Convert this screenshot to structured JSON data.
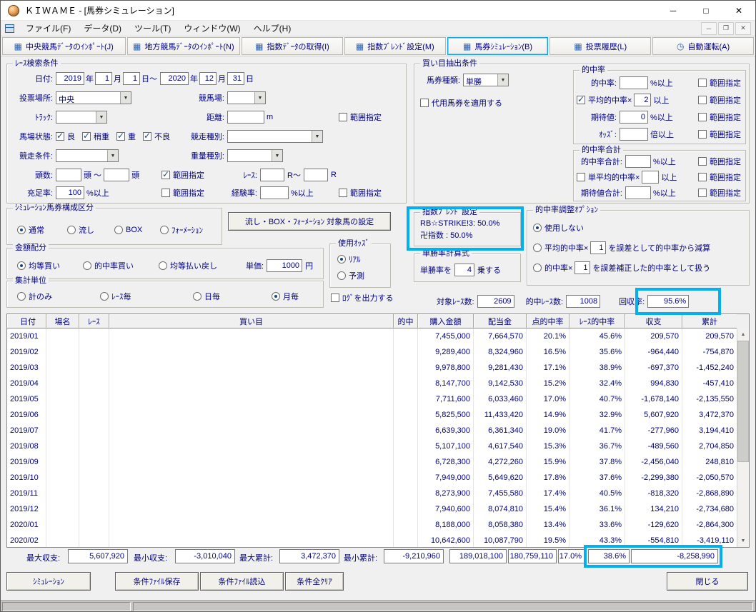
{
  "window": {
    "title": "ＫＩＷＡＭＥ - [馬券シミュレーション]",
    "minimize": "─",
    "maximize": "□",
    "close": "✕"
  },
  "menubar": {
    "items": [
      "ファイル(F)",
      "データ(D)",
      "ツール(T)",
      "ウィンドウ(W)",
      "ヘルプ(H)"
    ],
    "mdi_minimize": "─",
    "mdi_restore": "❐",
    "mdi_close": "✕"
  },
  "toolbar": {
    "buttons": [
      "中央競馬ﾃﾞｰﾀのｲﾝﾎﾟｰﾄ(J)",
      "地方競馬ﾃﾞｰﾀのｲﾝﾎﾟｰﾄ(N)",
      "指数ﾃﾞｰﾀの取得(I)",
      "指数ﾌﾞﾚﾝﾄﾞ設定(M)",
      "馬券ｼﾐｭﾚｰｼｮﾝ(B)",
      "投票履歴(L)",
      "自動運転(A)"
    ]
  },
  "range_label": "範囲指定",
  "search": {
    "title": "ﾚｰｽ検索条件",
    "date_label": "日付:",
    "from_year": "2019",
    "from_month": "1",
    "from_day": "1",
    "to_year": "2020",
    "to_month": "12",
    "to_day": "31",
    "u_year": "年",
    "u_month": "月",
    "u_day_tilde": "日～",
    "u_day": "日",
    "place_label": "投票場所:",
    "place_value": "中央",
    "course_label": "競馬場:",
    "course_value": "",
    "track_label": "ﾄﾗｯｸ:",
    "track_value": "",
    "distance_label": "距離:",
    "distance_value": "",
    "distance_unit": "m",
    "baba_label": "馬場状態:",
    "baba_options": [
      "良",
      "稍重",
      "重",
      "不良"
    ],
    "race_kind_label": "競走種別:",
    "race_kind_value": "",
    "race_cond_label": "競走条件:",
    "race_cond_value": "",
    "weight_kind_label": "重量種別:",
    "weight_kind_value": "",
    "heads_label": "頭数:",
    "heads_from": "",
    "heads_to": "",
    "u_head_tilde": "頭 ～",
    "u_head": "頭",
    "raceno_label": "ﾚｰｽ:",
    "raceno_from": "",
    "raceno_to": "",
    "u_r_tilde": "R～",
    "u_r": "R",
    "fill_label": "充足率:",
    "fill_value": "100",
    "u_pct_over": "%以上",
    "exp_label": "経験率:",
    "exp_value": ""
  },
  "extract": {
    "title": "買い目抽出条件",
    "ticket_label": "馬券種類:",
    "ticket_value": "単勝",
    "substitute_label": "代用馬券を適用する",
    "hit": {
      "title": "的中率",
      "rate_label": "的中率:",
      "rate_value": "",
      "u_pct": "%以上",
      "avg_label": "平均的中率×",
      "avg_value": "2",
      "u_over": "以上",
      "expect_label": "期待値:",
      "expect_value": "0",
      "odds_label": "ｵｯｽﾞ:",
      "odds_value": "",
      "u_times": "倍以上"
    },
    "total": {
      "title": "的中率合計",
      "rate_label": "的中率合計:",
      "rate_value": "",
      "u_pct": "%以上",
      "avg_label": "単平均的中率×",
      "avg_value": "",
      "u_over": "以上",
      "expect_label": "期待値合計:",
      "expect_value": ""
    }
  },
  "sim_type": {
    "title": "ｼﾐｭﾚｰｼｮﾝ馬券構成区分",
    "options": [
      "通常",
      "流し",
      "BOX",
      "ﾌｫｰﾒｰｼｮﾝ"
    ],
    "button_label": "流し・BOX・ﾌｫｰﾒｰｼｮﾝ 対象馬の設定"
  },
  "money": {
    "title": "金額配分",
    "options": [
      "均等買い",
      "的中率買い",
      "均等払い戻し"
    ],
    "price_label": "単価:",
    "price_value": "1000",
    "price_unit": "円"
  },
  "odds_used": {
    "title": "使用ｵｯｽﾞ",
    "options": [
      "ﾘｱﾙ",
      "予測"
    ]
  },
  "agg_unit": {
    "title": "集計単位",
    "options": [
      "計のみ",
      "ﾚｰｽ毎",
      "日毎",
      "月毎"
    ]
  },
  "log_label": "ﾛｸﾞを出力する",
  "blend": {
    "title": "指数ﾌﾞﾚﾝﾄﾞ設定",
    "line1": "RB☆STRIKE!3: 50.0%",
    "line2": "卍指数 : 50.0%"
  },
  "win_rate": {
    "title": "単勝率計算式",
    "prefix": "単勝率を",
    "value": "4",
    "suffix": "乗する"
  },
  "adjust": {
    "title": "的中率調整ｵﾌﾟｼｮﾝ",
    "opt1": "使用しない",
    "opt2_pre": "平均的中率×",
    "opt2_value": "1",
    "opt2_post": "を誤差として的中率から減算",
    "opt3_pre": "的中率×",
    "opt3_value": "1",
    "opt3_post": "を誤差補正した的中率として扱う"
  },
  "counts": {
    "target_label": "対象ﾚｰｽ数:",
    "target_value": "2609",
    "hit_label": "的中ﾚｰｽ数:",
    "hit_value": "1008",
    "payback_label": "回収率:",
    "payback_value": "95.6%"
  },
  "table": {
    "columns": [
      "日付",
      "場名",
      "ﾚｰｽ",
      "買い目",
      "的中",
      "購入金額",
      "配当金",
      "点的中率",
      "ﾚｰｽ的中率",
      "収支",
      "累計"
    ],
    "rows": [
      [
        "2019/01",
        "",
        "",
        "",
        "",
        "7,455,000",
        "7,664,570",
        "20.1%",
        "45.6%",
        "209,570",
        "209,570"
      ],
      [
        "2019/02",
        "",
        "",
        "",
        "",
        "9,289,400",
        "8,324,960",
        "16.5%",
        "35.6%",
        "-964,440",
        "-754,870"
      ],
      [
        "2019/03",
        "",
        "",
        "",
        "",
        "9,978,800",
        "9,281,430",
        "17.1%",
        "38.9%",
        "-697,370",
        "-1,452,240"
      ],
      [
        "2019/04",
        "",
        "",
        "",
        "",
        "8,147,700",
        "9,142,530",
        "15.2%",
        "32.4%",
        "994,830",
        "-457,410"
      ],
      [
        "2019/05",
        "",
        "",
        "",
        "",
        "7,711,600",
        "6,033,460",
        "17.0%",
        "40.7%",
        "-1,678,140",
        "-2,135,550"
      ],
      [
        "2019/06",
        "",
        "",
        "",
        "",
        "5,825,500",
        "11,433,420",
        "14.9%",
        "32.9%",
        "5,607,920",
        "3,472,370"
      ],
      [
        "2019/07",
        "",
        "",
        "",
        "",
        "6,639,300",
        "6,361,340",
        "19.0%",
        "41.7%",
        "-277,960",
        "3,194,410"
      ],
      [
        "2019/08",
        "",
        "",
        "",
        "",
        "5,107,100",
        "4,617,540",
        "15.3%",
        "36.7%",
        "-489,560",
        "2,704,850"
      ],
      [
        "2019/09",
        "",
        "",
        "",
        "",
        "6,728,300",
        "4,272,260",
        "15.9%",
        "37.8%",
        "-2,456,040",
        "248,810"
      ],
      [
        "2019/10",
        "",
        "",
        "",
        "",
        "7,949,000",
        "5,649,620",
        "17.8%",
        "37.6%",
        "-2,299,380",
        "-2,050,570"
      ],
      [
        "2019/11",
        "",
        "",
        "",
        "",
        "8,273,900",
        "7,455,580",
        "17.4%",
        "40.5%",
        "-818,320",
        "-2,868,890"
      ],
      [
        "2019/12",
        "",
        "",
        "",
        "",
        "7,940,600",
        "8,074,810",
        "15.4%",
        "36.1%",
        "134,210",
        "-2,734,680"
      ],
      [
        "2020/01",
        "",
        "",
        "",
        "",
        "8,188,000",
        "8,058,380",
        "13.4%",
        "33.6%",
        "-129,620",
        "-2,864,300"
      ],
      [
        "2020/02",
        "",
        "",
        "",
        "",
        "10,642,600",
        "10,087,790",
        "19.5%",
        "43.3%",
        "-554,810",
        "-3,419,110"
      ]
    ]
  },
  "summary": {
    "max_balance_label": "最大収支:",
    "max_balance": "5,607,920",
    "min_balance_label": "最小収支:",
    "min_balance": "-3,010,040",
    "max_cum_label": "最大累計:",
    "max_cum": "3,472,370",
    "min_cum_label": "最小累計:",
    "min_cum": "-9,210,960",
    "purchase_total": "189,018,100",
    "payout_total": "180,759,110",
    "hit_rate": "17.0%",
    "race_hit_rate": "38.6%",
    "balance": "-8,258,990"
  },
  "footer": {
    "buttons": [
      "ｼﾐｭﾚｰｼｮﾝ",
      "条件ﾌｧｲﾙ保存",
      "条件ﾌｧｲﾙ読込",
      "条件全ｸﾘｱ",
      "閉じる"
    ]
  },
  "colors": {
    "highlight": "#00b0f0",
    "text_navy": "#000080"
  }
}
